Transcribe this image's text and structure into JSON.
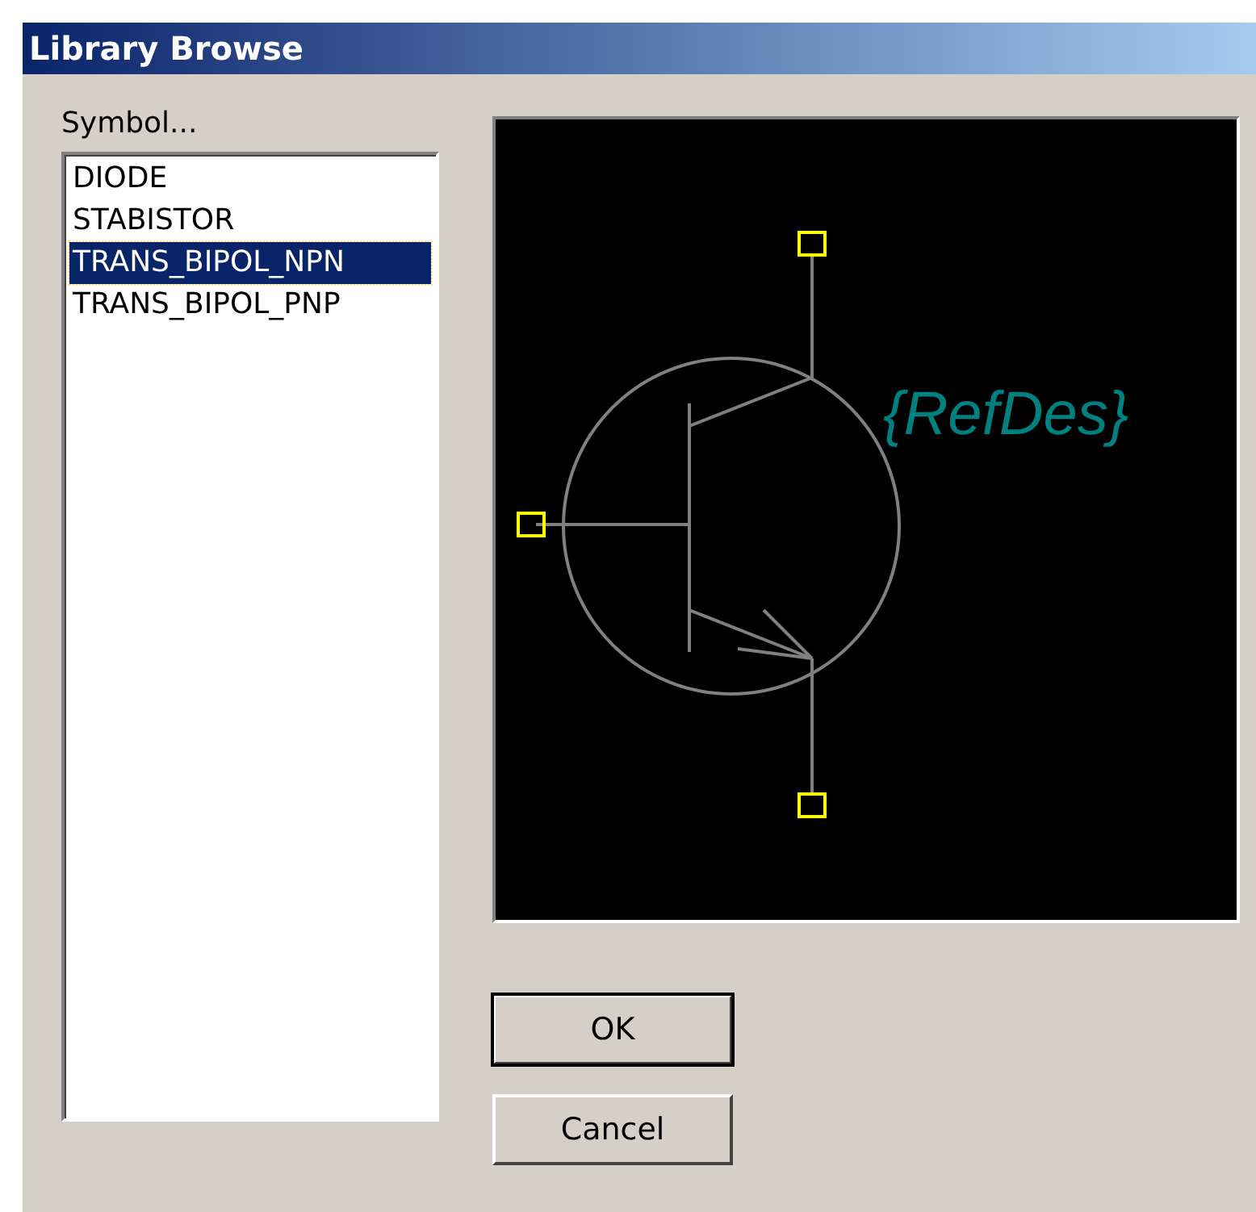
{
  "window": {
    "title": "Library Browse"
  },
  "symbol_list": {
    "label": "Symbol...",
    "items": [
      {
        "label": "DIODE",
        "selected": false
      },
      {
        "label": "STABISTOR",
        "selected": false
      },
      {
        "label": "TRANS_BIPOL_NPN",
        "selected": true
      },
      {
        "label": "TRANS_BIPOL_PNP",
        "selected": false
      }
    ]
  },
  "preview": {
    "refdes": "{RefDes}"
  },
  "buttons": [
    {
      "label": "OK",
      "kind": "default"
    },
    {
      "label": "Cancel",
      "kind": "normal"
    }
  ]
}
